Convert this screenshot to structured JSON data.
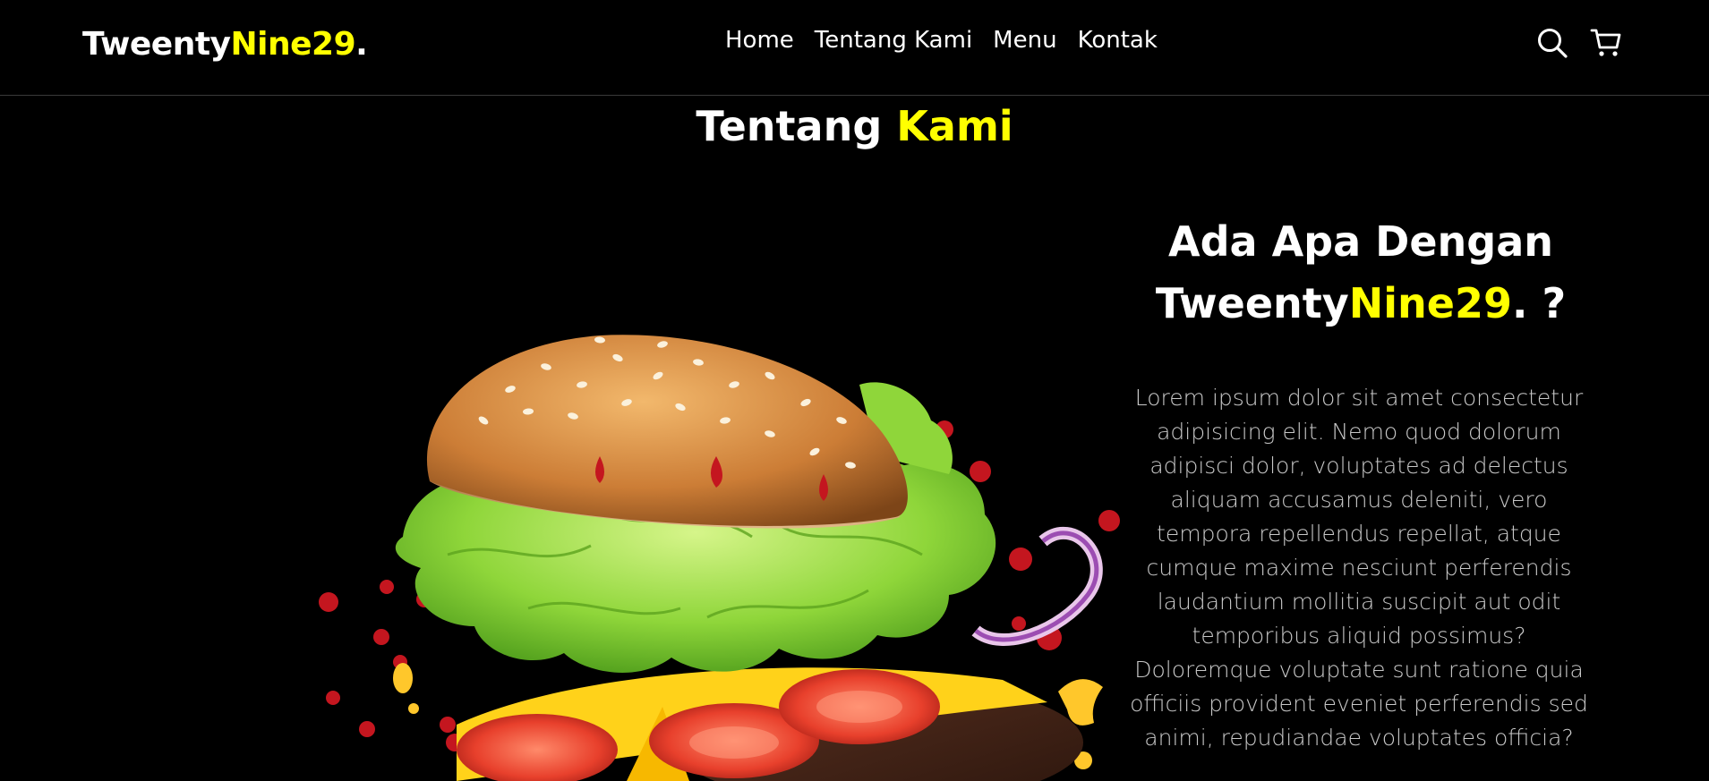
{
  "brand": {
    "part1": "Tweenty",
    "part2": "Nine29",
    "dot": "."
  },
  "nav": {
    "links": [
      "Home",
      "Tentang Kami",
      "Menu",
      "Kontak"
    ],
    "icons": [
      "search-icon",
      "cart-icon"
    ]
  },
  "section": {
    "title_part1": "Tentang ",
    "title_part2": "Kami"
  },
  "about": {
    "heading_line1": "Ada Apa Dengan",
    "heading_brand1": "Tweenty",
    "heading_brand2": "Nine29",
    "heading_suffix": ". ?",
    "paragraph1": "Lorem ipsum dolor sit amet consectetur adipisicing elit. Nemo quod dolorum adipisci dolor, voluptates ad delectus aliquam accusamus deleniti, vero tempora repellendus repellat, atque cumque maxime nesciunt perferendis laudantium mollitia suscipit aut odit temporibus aliquid possimus?",
    "paragraph2": "Doloremque voluptate sunt ratione quia officiis provident eveniet perferendis sed animi, repudiandae voluptates officia?"
  },
  "colors": {
    "accent": "#ffff00",
    "background": "#000000",
    "text": "#ffffff",
    "muted": "#c8c8c8"
  }
}
